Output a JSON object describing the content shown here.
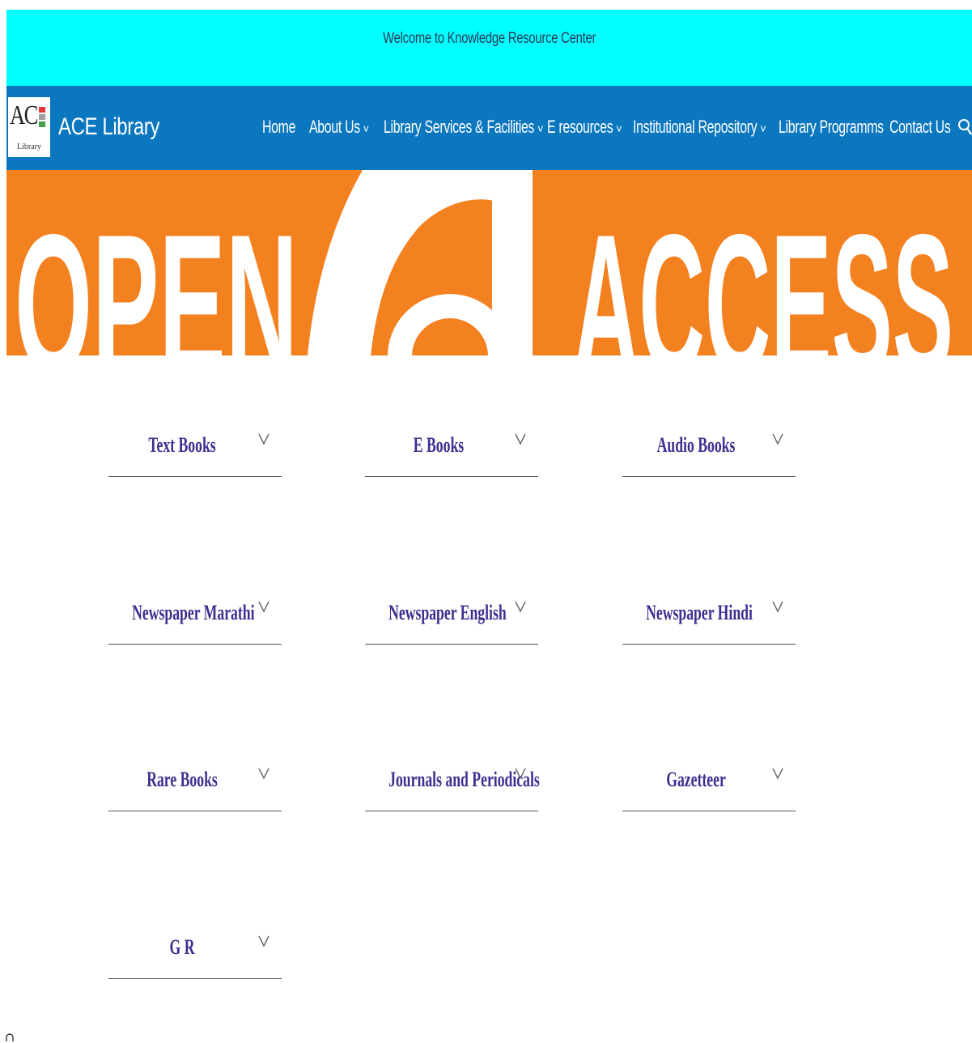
{
  "topbar": {
    "welcome_text": "Welcome to Knowledge Resource Center",
    "background": "#00ffff"
  },
  "header": {
    "logo_text": "AC",
    "logo_sub": "Library",
    "logo_bar_colors": [
      "#e53935",
      "#9e9e9e",
      "#43a047"
    ],
    "site_name": "ACE Library",
    "background": "#0b77bf"
  },
  "nav": {
    "items": [
      {
        "label": "Home",
        "has_dropdown": false
      },
      {
        "label": "About Us",
        "has_dropdown": true
      },
      {
        "label": "Library Services & Facilities",
        "has_dropdown": true
      },
      {
        "label": "E resources",
        "has_dropdown": true
      },
      {
        "label": "Institutional Repository",
        "has_dropdown": true
      },
      {
        "label": "Library Programms",
        "has_dropdown": false
      },
      {
        "label": "Contact Us",
        "has_dropdown": false
      }
    ],
    "caret_glyph": "v",
    "search_icon": "search-icon"
  },
  "banner": {
    "word_left": "OPEN",
    "word_right": "ACCESS",
    "background": "#f48120"
  },
  "sections": {
    "accent_color": "#3d2f8f",
    "items": [
      {
        "label": "Text Books"
      },
      {
        "label": "E Books"
      },
      {
        "label": "Audio Books"
      },
      {
        "label": "Newspaper Marathi"
      },
      {
        "label": "Newspaper English"
      },
      {
        "label": "Newspaper Hindi"
      },
      {
        "label": "Rare Books"
      },
      {
        "label": "Journals and Periodicals"
      },
      {
        "label": "Gazetteer"
      },
      {
        "label": "G R"
      }
    ]
  }
}
